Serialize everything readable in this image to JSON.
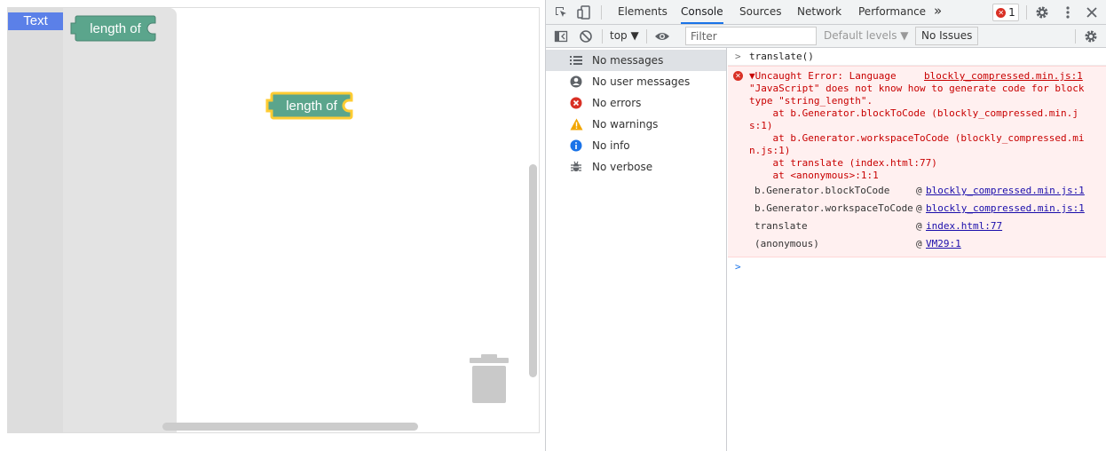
{
  "blockly": {
    "category_text": "Text",
    "flyout_block_label": "length of",
    "workspace_block_label": "length of",
    "block_color": "#5ba58c",
    "selected_outline_color": "#fc3"
  },
  "devtools": {
    "tabs": [
      "Elements",
      "Console",
      "Sources",
      "Network",
      "Performance"
    ],
    "more_tabs": "»",
    "active_tab": "Console",
    "error_count": "1",
    "toolbar": {
      "context": "top",
      "filter_placeholder": "Filter",
      "levels": "Default levels",
      "issues": "No Issues"
    },
    "sidebar": [
      {
        "label": "No messages",
        "icon": "list-icon"
      },
      {
        "label": "No user messages",
        "icon": "user-icon"
      },
      {
        "label": "No errors",
        "icon": "error-icon"
      },
      {
        "label": "No warnings",
        "icon": "warning-icon"
      },
      {
        "label": "No info",
        "icon": "info-icon"
      },
      {
        "label": "No verbose",
        "icon": "bug-icon"
      }
    ],
    "console": {
      "command": "translate()",
      "error_lines": [
        "▼Uncaught Error: Language",
        "\"JavaScript\" does not know how to generate code for block",
        "type \"string_length\".",
        "    at b.Generator.blockToCode (blockly_compressed.min.j",
        "s:1)",
        "    at b.Generator.workspaceToCode (blockly_compressed.mi",
        "n.js:1)",
        "    at translate (index.html:77)",
        "    at <anonymous>:1:1"
      ],
      "error_source": "blockly_compressed.min.js:1",
      "stack": [
        {
          "fn": "b.Generator.blockToCode",
          "at": "@",
          "link": "blockly_compressed.min.js:1"
        },
        {
          "fn": "b.Generator.workspaceToCode",
          "at": "@",
          "link": "blockly_compressed.min.js:1"
        },
        {
          "fn": "translate",
          "at": "@",
          "link": "index.html:77"
        },
        {
          "fn": "(anonymous)",
          "at": "@",
          "link": "VM29:1"
        }
      ]
    }
  }
}
